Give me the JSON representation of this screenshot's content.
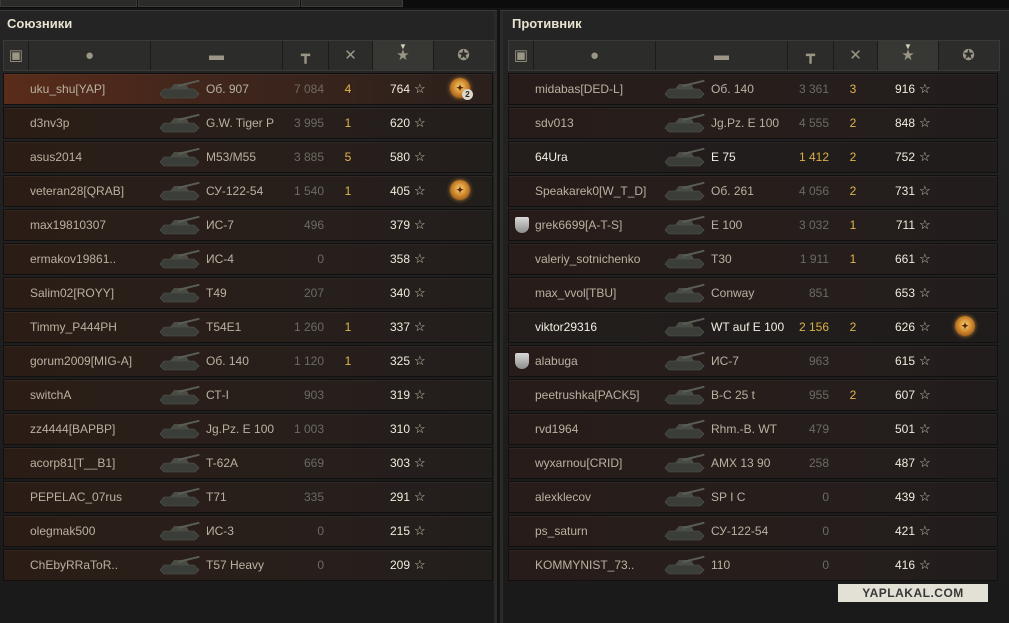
{
  "allies": {
    "title": "Союзники",
    "rows": [
      {
        "name": "uku_shu[YAP]",
        "tank": "Об. 907",
        "xp": "7 084",
        "kills": "4",
        "score": "764",
        "medal": "2",
        "highlight": true
      },
      {
        "name": "d3nv3p",
        "tank": "G.W. Tiger P",
        "xp": "3 995",
        "kills": "1",
        "score": "620"
      },
      {
        "name": "asus2014",
        "tank": "M53/M55",
        "xp": "3 885",
        "kills": "5",
        "score": "580"
      },
      {
        "name": "veteran28[QRAB]",
        "tank": "СУ-122-54",
        "xp": "1 540",
        "kills": "1",
        "score": "405",
        "medal": ""
      },
      {
        "name": "max19810307",
        "tank": "ИС-7",
        "xp": "496",
        "kills": "",
        "score": "379"
      },
      {
        "name": "ermakov19861..",
        "tank": "ИС-4",
        "xp": "0",
        "kills": "",
        "score": "358"
      },
      {
        "name": "Salim02[ROYY]",
        "tank": "T49",
        "xp": "207",
        "kills": "",
        "score": "340"
      },
      {
        "name": "Timmy_P444PH",
        "tank": "T54E1",
        "xp": "1 260",
        "kills": "1",
        "score": "337"
      },
      {
        "name": "gorum2009[MIG-A]",
        "tank": "Об. 140",
        "xp": "1 120",
        "kills": "1",
        "score": "325"
      },
      {
        "name": "switchA",
        "tank": "СТ-I",
        "xp": "903",
        "kills": "",
        "score": "319"
      },
      {
        "name": "zz4444[BAPBP]",
        "tank": "Jg.Pz. E 100",
        "xp": "1 003",
        "kills": "",
        "score": "310"
      },
      {
        "name": "acorp81[T__B1]",
        "tank": "T-62A",
        "xp": "669",
        "kills": "",
        "score": "303"
      },
      {
        "name": "PEPELAC_07rus",
        "tank": "T71",
        "xp": "335",
        "kills": "",
        "score": "291"
      },
      {
        "name": "olegmak500",
        "tank": "ИС-3",
        "xp": "0",
        "kills": "",
        "score": "215"
      },
      {
        "name": "ChEbyRRaToR..",
        "tank": "T57 Heavy",
        "xp": "0",
        "kills": "",
        "score": "209"
      }
    ]
  },
  "enemies": {
    "title": "Противник",
    "rows": [
      {
        "name": "midabas[DED-L]",
        "tank": "Об. 140",
        "xp": "3 361",
        "kills": "3",
        "score": "916"
      },
      {
        "name": "sdv013",
        "tank": "Jg.Pz. E 100",
        "xp": "4 555",
        "kills": "2",
        "score": "848"
      },
      {
        "name": "64Ura",
        "tank": "E 75",
        "xp": "1 412",
        "kills": "2",
        "score": "752",
        "bright": true
      },
      {
        "name": "Speakarek0[W_T_D]",
        "tank": "Об. 261",
        "xp": "4 056",
        "kills": "2",
        "score": "731"
      },
      {
        "name": "grek6699[A-T-S]",
        "tank": "E 100",
        "xp": "3 032",
        "kills": "1",
        "score": "711",
        "shield": true
      },
      {
        "name": "valeriy_sotnichenko",
        "tank": "T30",
        "xp": "1 911",
        "kills": "1",
        "score": "661"
      },
      {
        "name": "max_vvol[TBU]",
        "tank": "Conway",
        "xp": "851",
        "kills": "",
        "score": "653"
      },
      {
        "name": "viktor29316",
        "tank": "WT auf E 100",
        "xp": "2 156",
        "kills": "2",
        "score": "626",
        "bright": true,
        "medal": ""
      },
      {
        "name": "alabuga",
        "tank": "ИС-7",
        "xp": "963",
        "kills": "",
        "score": "615",
        "shield": true
      },
      {
        "name": "peetrushka[PACK5]",
        "tank": "B-C 25 t",
        "xp": "955",
        "kills": "2",
        "score": "607"
      },
      {
        "name": "rvd1964",
        "tank": "Rhm.-B. WT",
        "xp": "479",
        "kills": "",
        "score": "501"
      },
      {
        "name": "wyxarnou[CRID]",
        "tank": "AMX 13 90",
        "xp": "258",
        "kills": "",
        "score": "487"
      },
      {
        "name": "alexklecov",
        "tank": "SP I C",
        "xp": "0",
        "kills": "",
        "score": "439"
      },
      {
        "name": "ps_saturn",
        "tank": "СУ-122-54",
        "xp": "0",
        "kills": "",
        "score": "421"
      },
      {
        "name": "KOMMYNIST_73..",
        "tank": "110",
        "xp": "0",
        "kills": "",
        "score": "416"
      }
    ]
  },
  "star_glyph": "☆",
  "header_icons": [
    "platoon-icon",
    "player-icon",
    "tank-icon",
    "damage-icon",
    "kills-icon",
    "xp-star-icon",
    "medal-icon"
  ],
  "watermark": "YAPLAKAL.COM"
}
